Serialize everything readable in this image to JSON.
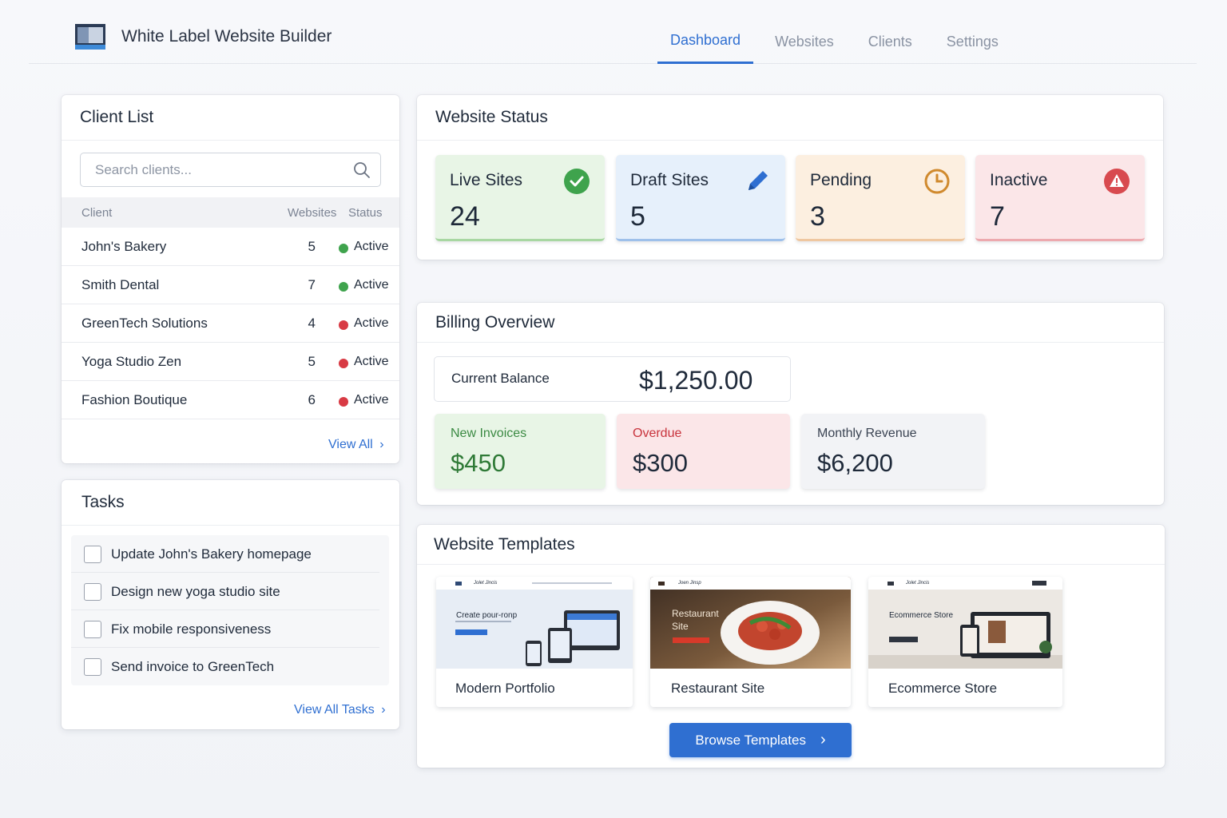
{
  "app": {
    "title": "White Label Website Builder",
    "accent": "#2f6fd1"
  },
  "nav": {
    "tabs": [
      {
        "label": "Dashboard",
        "active": true
      },
      {
        "label": "Websites",
        "active": false
      },
      {
        "label": "Clients",
        "active": false
      },
      {
        "label": "Settings",
        "active": false
      }
    ]
  },
  "clients": {
    "title": "Client List",
    "search_placeholder": "Search clients...",
    "columns": [
      "Client",
      "Websites",
      "Status"
    ],
    "rows": [
      {
        "name": "John's Bakery",
        "websites": "5",
        "status": "Active",
        "dot_color": "#3fa34d"
      },
      {
        "name": "Smith Dental",
        "websites": "7",
        "status": "Active",
        "dot_color": "#3fa34d"
      },
      {
        "name": "GreenTech Solutions",
        "websites": "4",
        "status": "Active",
        "dot_color": "#d83a44"
      },
      {
        "name": "Yoga Studio Zen",
        "websites": "5",
        "status": "Active",
        "dot_color": "#d83a44"
      },
      {
        "name": "Fashion Boutique",
        "websites": "6",
        "status": "Active",
        "dot_color": "#d83a44"
      }
    ],
    "view_all": "View All"
  },
  "tasks": {
    "title": "Tasks",
    "items": [
      {
        "label": "Update John's Bakery homepage",
        "checked": false
      },
      {
        "label": "Design new yoga studio site",
        "checked": false
      },
      {
        "label": "Fix mobile responsiveness",
        "checked": false
      },
      {
        "label": "Send invoice to GreenTech",
        "checked": false
      }
    ],
    "view_all": "View All Tasks"
  },
  "status": {
    "title": "Website Status",
    "cards": [
      {
        "label": "Live Sites",
        "value": "24",
        "icon": "check-circle-icon",
        "bg": "#e8f5e6",
        "bar": "#a8d7a2"
      },
      {
        "label": "Draft Sites",
        "value": "5",
        "icon": "pencil-icon",
        "bg": "#e6f0fb",
        "bar": "#9ec0ea"
      },
      {
        "label": "Pending",
        "value": "3",
        "icon": "clock-icon",
        "bg": "#fcefe0",
        "bar": "#efc7a0"
      },
      {
        "label": "Inactive",
        "value": "7",
        "icon": "warning-icon",
        "bg": "#fbe6e8",
        "bar": "#eda9ae"
      }
    ]
  },
  "billing": {
    "title": "Billing Overview",
    "balance_label": "Current Balance",
    "balance_value": "$1,250.00",
    "cards": [
      {
        "label": "New Invoices",
        "value": "$450",
        "label_color": "#3b8a43",
        "value_color": "#2f7a37",
        "bg": "#e8f5e6"
      },
      {
        "label": "Overdue",
        "value": "$300",
        "label_color": "#c8333c",
        "value_color": "#1f2a3a",
        "bg": "#fbe6e8"
      },
      {
        "label": "Monthly Revenue",
        "value": "$6,200",
        "label_color": "#3a4352",
        "value_color": "#1f2a3a",
        "bg": "#f2f3f6"
      }
    ]
  },
  "templates": {
    "title": "Website Templates",
    "items": [
      {
        "name": "Modern Portfolio",
        "thumb_heading": "Create pour-ronp",
        "brand": "Jolet Jincis"
      },
      {
        "name": "Restaurant Site",
        "thumb_heading": "Restaurant Site",
        "brand": "Joen Jinsp"
      },
      {
        "name": "Ecommerce Store",
        "thumb_heading": "Ecommerce Store",
        "brand": "Jolet Jincis"
      }
    ],
    "browse_label": "Browse Templates"
  }
}
